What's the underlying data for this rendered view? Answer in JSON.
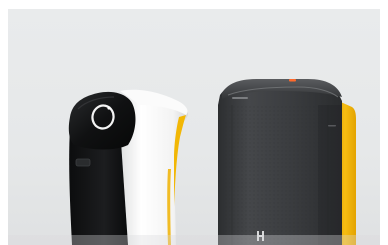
{
  "image": {
    "subjects": [
      "robot-white-black",
      "robot-dark-yellow"
    ],
    "colors": {
      "background": "#e6e8e9",
      "left_robot_black": "#141516",
      "left_robot_white": "#f7f7f7",
      "accent_yellow": "#f2b705",
      "right_robot_body": "#3a3c3e",
      "right_robot_dark": "#26282a",
      "status_orange": "#ff6a2c"
    }
  }
}
